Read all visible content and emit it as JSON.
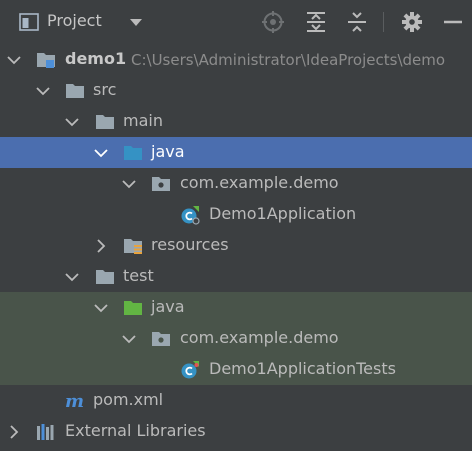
{
  "toolbar": {
    "title": "Project",
    "icons": [
      "project-view-icon",
      "dropdown-arrow-icon",
      "locate-icon",
      "expand-all-icon",
      "collapse-all-icon",
      "gear-icon",
      "minimize-icon"
    ]
  },
  "tree": {
    "root": {
      "label": "demo1",
      "path": "C:\\Users\\Administrator\\IdeaProjects\\demo"
    },
    "src": "src",
    "main": "main",
    "main_java": "java",
    "main_package": "com.example.demo",
    "main_class": "Demo1Application",
    "resources": "resources",
    "test": "test",
    "test_java": "java",
    "test_package": "com.example.demo",
    "test_class": "Demo1ApplicationTests",
    "pom": "pom.xml",
    "external": "External Libraries"
  },
  "colors": {
    "background": "#3c3f41",
    "selection": "#4b6eaf",
    "test_highlight": "#49544a",
    "folder_gray": "#9aa7b0",
    "folder_blue": "#3592c4",
    "folder_green": "#62b543",
    "maven_blue": "#4d8fd8"
  }
}
